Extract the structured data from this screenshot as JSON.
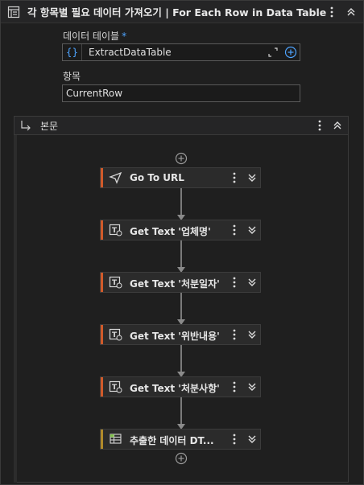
{
  "header": {
    "title": "각 항목별 필요 데이터 가져오기 | For Each Row in Data Table",
    "icon": "for-each-icon"
  },
  "fields": {
    "datatable_label": "데이터 테이블",
    "datatable_required": "*",
    "datatable_value": "ExtractDataTable",
    "datatable_prefix": "{}",
    "item_label": "항목",
    "item_value": "CurrentRow"
  },
  "body": {
    "label": "본문"
  },
  "activities": [
    {
      "name": "Go To URL",
      "icon": "navigate-icon",
      "stripe": "#d05a2a"
    },
    {
      "name": "Get Text '업체명'",
      "icon": "get-text-icon",
      "stripe": "#d05a2a"
    },
    {
      "name": "Get Text '처분일자'",
      "icon": "get-text-icon",
      "stripe": "#d05a2a"
    },
    {
      "name": "Get Text '위반내용'",
      "icon": "get-text-icon",
      "stripe": "#d05a2a"
    },
    {
      "name": "Get Text '처분사항'",
      "icon": "get-text-icon",
      "stripe": "#d05a2a"
    },
    {
      "name": "추출한 데이터 DT...",
      "icon": "datatable-icon",
      "stripe": "#b08a2a"
    }
  ],
  "colors": {
    "accent": "#4ea4ff",
    "ui_stripe": "#d05a2a",
    "data_stripe": "#b08a2a"
  }
}
